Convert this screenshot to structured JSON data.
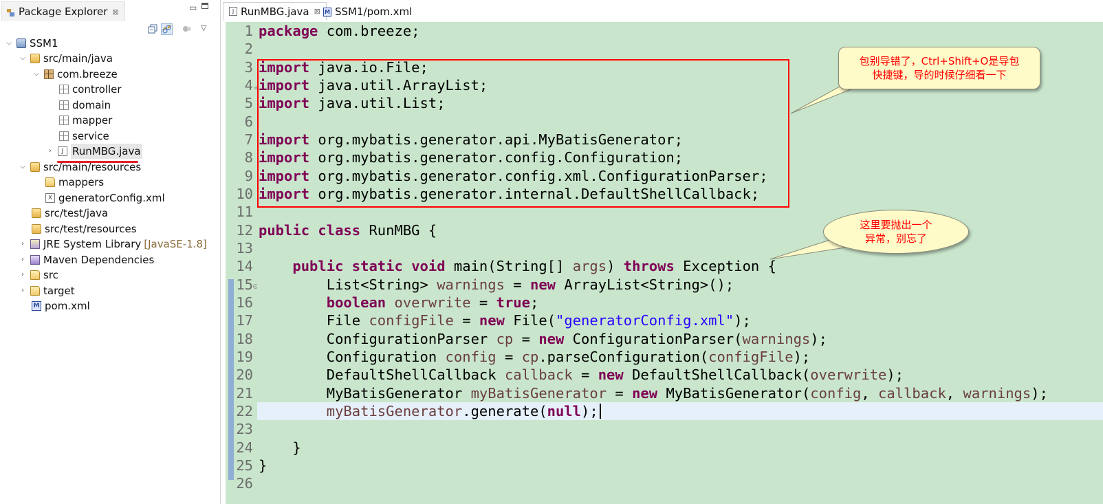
{
  "explorer": {
    "tab_label": "Package Explorer",
    "close_glyph": "⊠",
    "minimize_glyph": "▭",
    "tree": [
      {
        "label": "SSM1",
        "icon": "project-icon"
      },
      {
        "label": "src/main/java",
        "icon": "source-folder-icon"
      },
      {
        "label": "com.breeze",
        "icon": "package-icon"
      },
      {
        "label": "controller",
        "icon": "empty-package-icon"
      },
      {
        "label": "domain",
        "icon": "empty-package-icon"
      },
      {
        "label": "mapper",
        "icon": "empty-package-icon"
      },
      {
        "label": "service",
        "icon": "empty-package-icon"
      },
      {
        "label": "RunMBG.java",
        "icon": "java-file-icon"
      },
      {
        "label": "src/main/resources",
        "icon": "source-folder-icon"
      },
      {
        "label": "mappers",
        "icon": "folder-icon"
      },
      {
        "label": "generatorConfig.xml",
        "icon": "xml-file-icon"
      },
      {
        "label": "src/test/java",
        "icon": "source-folder-icon"
      },
      {
        "label": "src/test/resources",
        "icon": "source-folder-icon"
      },
      {
        "label": "JRE System Library",
        "suffix": "[JavaSE-1.8]",
        "icon": "library-icon"
      },
      {
        "label": "Maven Dependencies",
        "icon": "maven-library-icon"
      },
      {
        "label": "src",
        "icon": "folder-icon"
      },
      {
        "label": "target",
        "icon": "folder-icon"
      },
      {
        "label": "pom.xml",
        "icon": "pom-file-icon"
      }
    ]
  },
  "editor": {
    "tabs": [
      {
        "label": "RunMBG.java",
        "icon": "java-file-icon",
        "active": true,
        "close": "⊠"
      },
      {
        "label": "SSM1/pom.xml",
        "icon": "pom-file-icon",
        "active": false
      }
    ],
    "line_numbers": [
      "1",
      "2",
      "3",
      "4",
      "5",
      "6",
      "7",
      "8",
      "9",
      "10",
      "11",
      "12",
      "13",
      "14",
      "15",
      "16",
      "17",
      "18",
      "19",
      "20",
      "21",
      "22",
      "23",
      "24",
      "25",
      "26"
    ],
    "code": {
      "l1_kw": "package",
      "l1_rest": " com.breeze;",
      "imp": "import",
      "l3": " java.io.File;",
      "l4": " java.util.ArrayList;",
      "l5": " java.util.List;",
      "l7": " org.mybatis.generator.api.MyBatisGenerator;",
      "l8": " org.mybatis.generator.config.Configuration;",
      "l9": " org.mybatis.generator.config.xml.ConfigurationParser;",
      "l10": " org.mybatis.generator.internal.DefaultShellCallback;",
      "l12_kw1": "public",
      "l12_kw2": "class",
      "l12_rest": " RunMBG {",
      "l14_kw1": "public",
      "l14_kw2": "static",
      "l14_kw3": "void",
      "l14_a": " main(String[] ",
      "l14_var": "args",
      "l14_b": ") ",
      "l14_kw4": "throws",
      "l14_c": " Exception {",
      "l15_a": "List<String> ",
      "l15_var": "warnings",
      "l15_b": " = ",
      "l15_kw": "new",
      "l15_c": " ArrayList<String>();",
      "l16_kw": "boolean",
      "l16_a": " ",
      "l16_var": "overwrite",
      "l16_b": " = ",
      "l16_kw2": "true",
      "l16_c": ";",
      "l17_a": "File ",
      "l17_var": "configFile",
      "l17_b": " = ",
      "l17_kw": "new",
      "l17_c": " File(",
      "l17_str": "\"generatorConfig.xml\"",
      "l17_d": ");",
      "l18_a": "ConfigurationParser ",
      "l18_var": "cp",
      "l18_b": " = ",
      "l18_kw": "new",
      "l18_c": " ConfigurationParser(",
      "l18_var2": "warnings",
      "l18_d": ");",
      "l19_a": "Configuration ",
      "l19_var": "config",
      "l19_b": " = ",
      "l19_var2": "cp",
      "l19_c": ".parseConfiguration(",
      "l19_var3": "configFile",
      "l19_d": ");",
      "l20_a": "DefaultShellCallback ",
      "l20_var": "callback",
      "l20_b": " = ",
      "l20_kw": "new",
      "l20_c": " DefaultShellCallback(",
      "l20_var2": "overwrite",
      "l20_d": ");",
      "l21_a": "MyBatisGenerator ",
      "l21_var": "myBatisGenerator",
      "l21_b": " = ",
      "l21_kw": "new",
      "l21_c": " MyBatisGenerator(",
      "l21_var2": "config",
      "l21_d": ", ",
      "l21_var3": "callback",
      "l21_e": ", ",
      "l21_var4": "warnings",
      "l21_f": ");",
      "l22_var": "myBatisGenerator",
      "l22_a": ".generate(",
      "l22_kw": "null",
      "l22_b": ");",
      "l24": "}",
      "l25": "}"
    }
  },
  "callouts": {
    "c1_line1": "包别导错了，Ctrl+Shift+O是导包",
    "c1_line2": "快捷键，导的时候仔细看一下",
    "c2_line1": "这里要抛出一个",
    "c2_line2": "异常，别忘了"
  },
  "colors": {
    "editor_bg": "#c9e6cc",
    "keyword": "#7f0055",
    "variable": "#6a3e3e",
    "string": "#2a00ff",
    "annotation": "#ff0000"
  }
}
